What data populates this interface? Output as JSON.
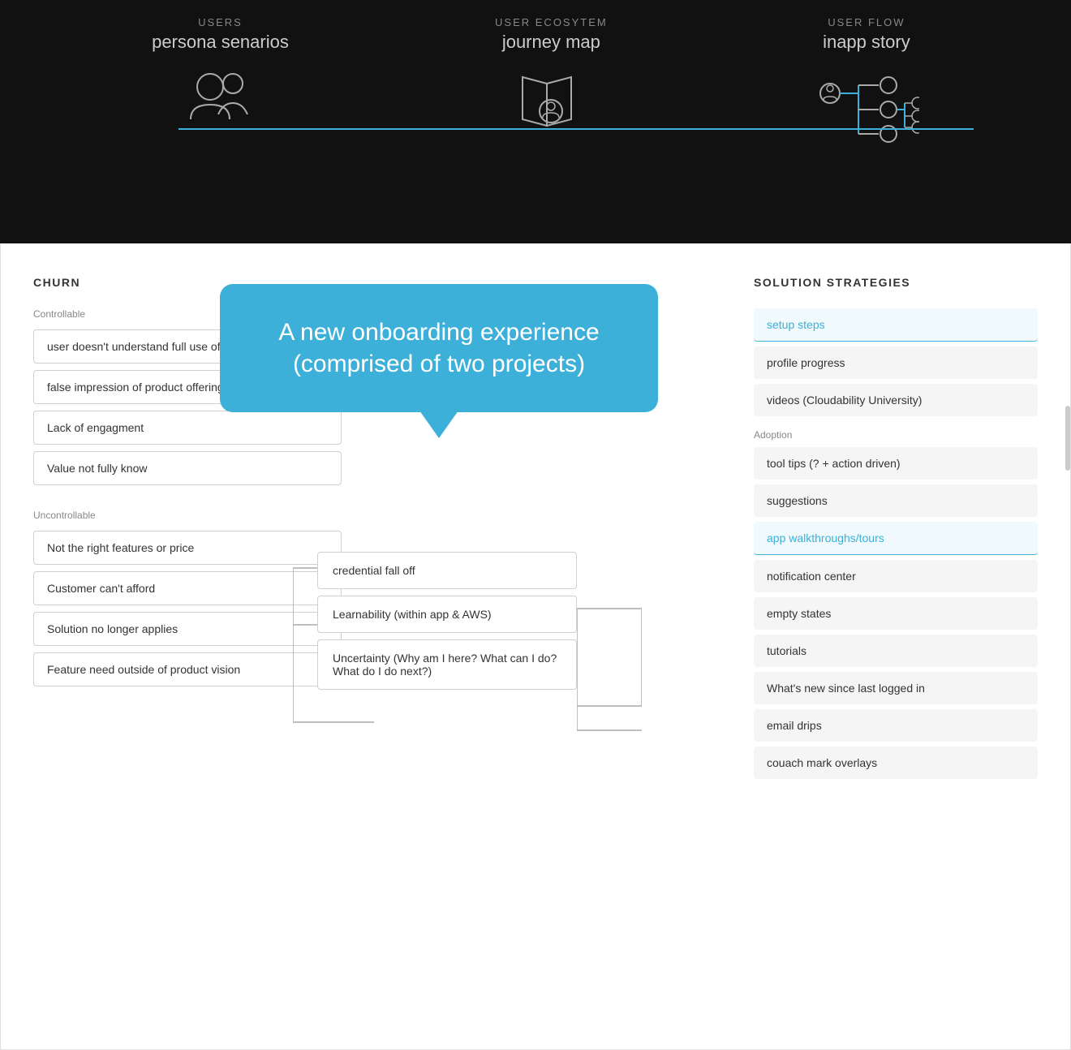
{
  "top": {
    "col1": {
      "upper": "USERS",
      "lower": "persona senarios"
    },
    "col2": {
      "upper": "USER ECOSYTEM",
      "lower": "journey map"
    },
    "col3": {
      "upper": "USER FLOW",
      "lower": "inapp story"
    }
  },
  "callout": {
    "text": "A new onboarding experience (comprised of two projects)"
  },
  "churn": {
    "header": "CHURN",
    "controllable_label": "Controllable",
    "controllable_items": [
      "user doesn't understand full use of product",
      "false impression of product offering",
      "Lack of engagment",
      "Value not fully know"
    ],
    "uncontrollable_label": "Uncontrollable",
    "uncontrollable_items": [
      "Not the right features or price",
      "Customer can't afford",
      "Solution no longer applies",
      "Feature need outside of product vision"
    ]
  },
  "middle": {
    "items": [
      "credential fall off",
      "Learnability (within app & AWS)",
      "Uncertainty (Why am I here? What can I do? What do I do next?)"
    ]
  },
  "solution": {
    "header": "SOLUTION STRATEGIES",
    "groups": [
      {
        "label": "",
        "items": [
          {
            "text": "setup steps",
            "highlighted": true
          },
          {
            "text": "profile progress",
            "highlighted": false
          },
          {
            "text": "videos (Cloudability University)",
            "highlighted": false
          }
        ]
      },
      {
        "label": "Adoption",
        "items": [
          {
            "text": "tool tips (? + action driven)",
            "highlighted": false
          },
          {
            "text": "suggestions",
            "highlighted": false
          },
          {
            "text": "app walkthroughs/tours",
            "highlighted": true
          },
          {
            "text": "notification center",
            "highlighted": false
          },
          {
            "text": "empty states",
            "highlighted": false
          },
          {
            "text": "tutorials",
            "highlighted": false
          },
          {
            "text": "What's new since last logged in",
            "highlighted": false
          },
          {
            "text": "email drips",
            "highlighted": false
          },
          {
            "text": "couach mark overlays",
            "highlighted": false
          }
        ]
      }
    ]
  }
}
